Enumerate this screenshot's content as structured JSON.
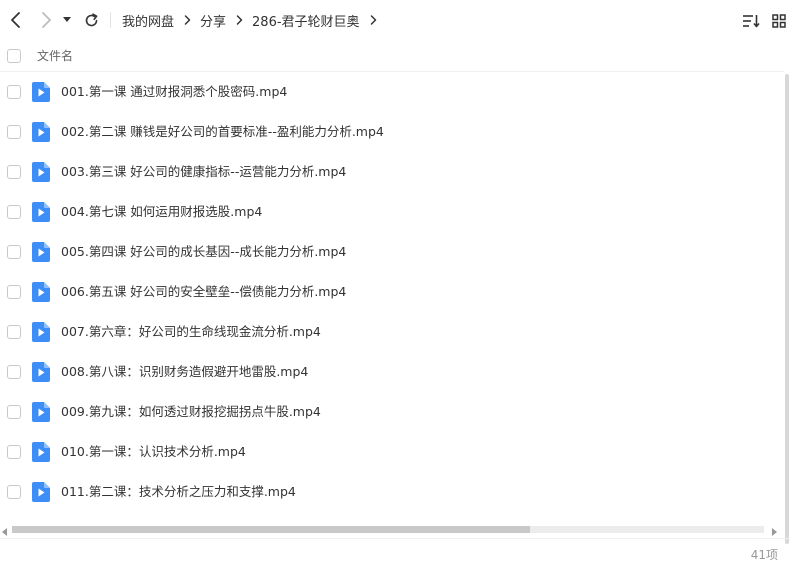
{
  "toolbar": {
    "back_icon": "chevron-left-icon",
    "forward_icon": "chevron-right-icon",
    "history_icon": "caret-down-icon",
    "refresh_icon": "refresh-icon",
    "sort_icon": "sort-list-icon",
    "grid_icon": "grid-view-icon"
  },
  "breadcrumb": {
    "items": [
      "我的网盘",
      "分享",
      "286-君子轮财巨奥"
    ]
  },
  "header": {
    "name_column": "文件名"
  },
  "files": [
    {
      "name": "001.第一课 通过财报洞悉个股密码.mp4",
      "icon": "video-file-icon"
    },
    {
      "name": "002.第二课 赚钱是好公司的首要标准--盈利能力分析.mp4",
      "icon": "video-file-icon"
    },
    {
      "name": "003.第三课 好公司的健康指标--运营能力分析.mp4",
      "icon": "video-file-icon"
    },
    {
      "name": "004.第七课 如何运用财报选股.mp4",
      "icon": "video-file-icon"
    },
    {
      "name": "005.第四课 好公司的成长基因--成长能力分析.mp4",
      "icon": "video-file-icon"
    },
    {
      "name": "006.第五课 好公司的安全壁垒--偿债能力分析.mp4",
      "icon": "video-file-icon"
    },
    {
      "name": "007.第六章：好公司的生命线现金流分析.mp4",
      "icon": "video-file-icon"
    },
    {
      "name": "008.第八课：识别财务造假避开地雷股.mp4",
      "icon": "video-file-icon"
    },
    {
      "name": "009.第九课：如何透过财报挖掘拐点牛股.mp4",
      "icon": "video-file-icon"
    },
    {
      "name": "010.第一课：认识技术分析.mp4",
      "icon": "video-file-icon"
    },
    {
      "name": "011.第二课：技术分析之压力和支撑.mp4",
      "icon": "video-file-icon"
    }
  ],
  "status": {
    "item_count": "41项"
  },
  "colors": {
    "file_icon_blue": "#3d8ef7",
    "text": "#333333",
    "muted": "#999999"
  }
}
